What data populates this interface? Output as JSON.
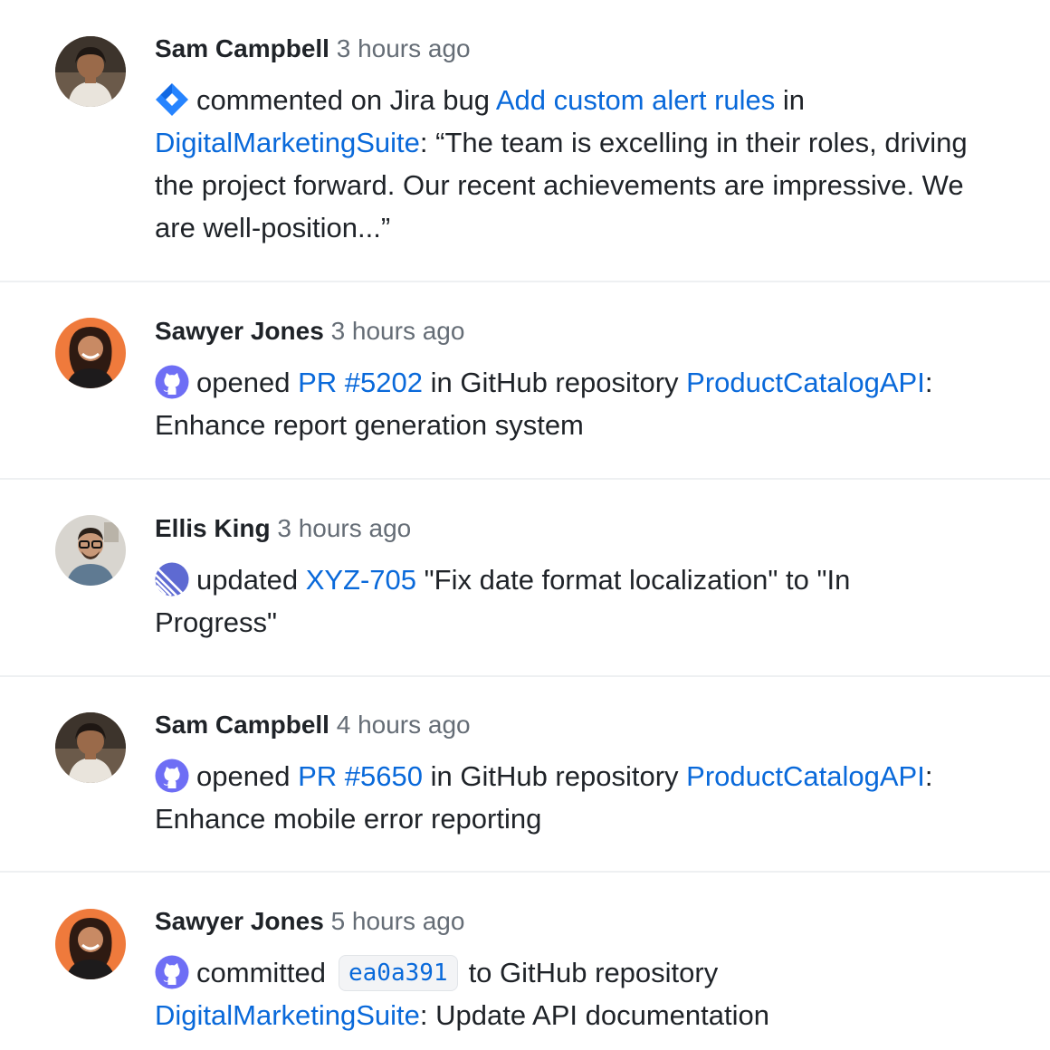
{
  "feed": {
    "items": [
      {
        "author": "Sam Campbell",
        "time": "3 hours ago",
        "source_icon": "jira-icon",
        "verb": "commented on Jira bug",
        "link": "Add custom alert rules",
        "mid": "in",
        "repo": "DigitalMarketingSuite",
        "tail": ": “The team is excelling in their roles, driving the project forward. Our recent achievements are impressive. We are well-position...”"
      },
      {
        "author": "Sawyer Jones",
        "time": "3 hours ago",
        "source_icon": "github-icon",
        "verb": "opened",
        "link": "PR #5202",
        "mid": "in GitHub repository",
        "repo": "ProductCatalogAPI",
        "tail": ": Enhance report generation system"
      },
      {
        "author": "Ellis King",
        "time": "3 hours ago",
        "source_icon": "linear-icon",
        "verb": "updated",
        "link": "XYZ-705",
        "tail": "\"Fix date format localization\" to \"In Progress\""
      },
      {
        "author": "Sam Campbell",
        "time": "4 hours ago",
        "source_icon": "github-icon",
        "verb": "opened",
        "link": "PR #5650",
        "mid": "in GitHub repository",
        "repo": "ProductCatalogAPI",
        "tail": ": Enhance mobile error reporting"
      },
      {
        "author": "Sawyer Jones",
        "time": "5 hours ago",
        "source_icon": "github-icon",
        "verb": "committed",
        "sha": "ea0a391",
        "mid": "to GitHub repository",
        "repo": "DigitalMarketingSuite",
        "tail": ": Update API documentation"
      }
    ]
  },
  "colors": {
    "link": "#0969da",
    "author": "#1f2328",
    "time": "#656d76",
    "jira": "#2684ff",
    "github_badge": "#6e6ef5",
    "linear": "#5e6ad2",
    "divider": "#eef0f2"
  }
}
